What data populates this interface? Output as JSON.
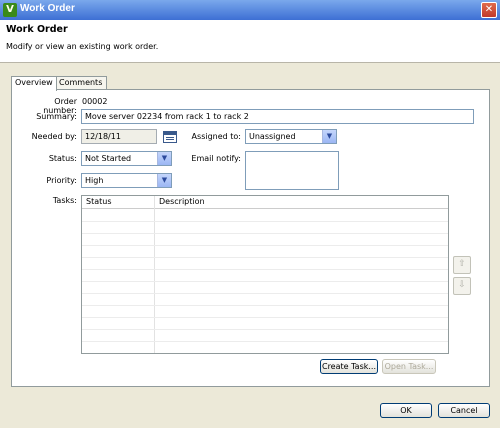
{
  "window": {
    "title": "Work Order",
    "close_glyph": "✕"
  },
  "header": {
    "title": "Work Order",
    "subtitle": "Modify or view an existing work order."
  },
  "tabs": [
    {
      "label": "Overview",
      "active": true
    },
    {
      "label": "Comments",
      "active": false
    }
  ],
  "form": {
    "order_number_label": "Order number:",
    "order_number": "00002",
    "summary_label": "Summary:",
    "summary": "Move server 02234 from rack 1 to rack 2",
    "needed_by_label": "Needed by:",
    "needed_by": "12/18/11",
    "assigned_to_label": "Assigned to:",
    "assigned_to": "Unassigned",
    "status_label": "Status:",
    "status": "Not Started",
    "email_notify_label": "Email notify:",
    "priority_label": "Priority:",
    "priority": "High",
    "tasks_label": "Tasks:"
  },
  "tasks_table": {
    "columns": [
      "Status",
      "Description"
    ],
    "rows": []
  },
  "buttons": {
    "create_task": "Create Task...",
    "open_task": "Open Task...",
    "ok": "OK",
    "cancel": "Cancel",
    "move_up_glyph": "⇧",
    "move_down_glyph": "⇩"
  },
  "colors": {
    "title_bar": "#3d6fd4",
    "window_bg": "#ece9d8",
    "input_border": "#7f9db9"
  },
  "icons": [
    "app-icon",
    "close-icon",
    "calendar-icon",
    "chevron-down-icon",
    "arrow-up-icon",
    "arrow-down-icon"
  ]
}
